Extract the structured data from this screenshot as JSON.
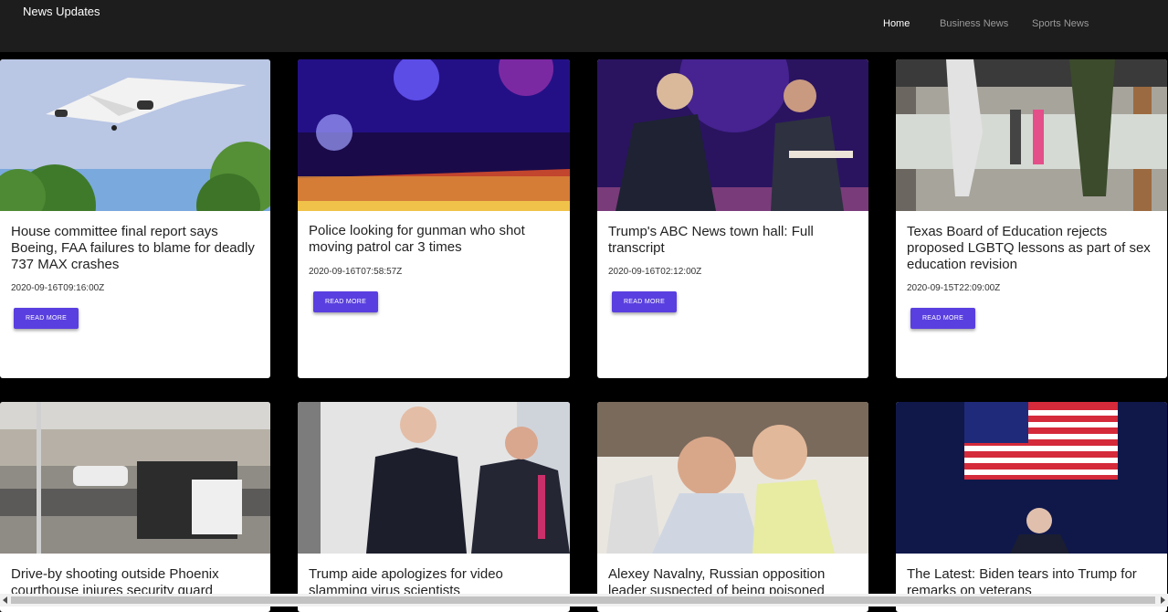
{
  "header": {
    "brand": "News Updates",
    "nav": [
      {
        "label": "Home",
        "active": true
      },
      {
        "label": "Business News",
        "active": false
      },
      {
        "label": "Sports News",
        "active": false
      }
    ]
  },
  "cards": [
    {
      "title": "House committee final report says Boeing, FAA failures to blame for deadly 737 MAX crashes",
      "date": "2020-09-16T09:16:00Z",
      "button": "READ MORE",
      "image": "airplane-photo"
    },
    {
      "title": "Police looking for gunman who shot moving patrol car 3 times",
      "date": "2020-09-16T07:58:57Z",
      "button": "READ MORE",
      "image": "police-tape-photo"
    },
    {
      "title": "Trump's ABC News town hall: Full transcript",
      "date": "2020-09-16T02:12:00Z",
      "button": "READ MORE",
      "image": "town-hall-photo"
    },
    {
      "title": "Texas Board of Education rejects proposed LGBTQ lessons as part of sex education revision",
      "date": "2020-09-15T22:09:00Z",
      "button": "READ MORE",
      "image": "school-students-photo"
    },
    {
      "title": "Drive-by shooting outside Phoenix courthouse injures security guard",
      "date": "",
      "button": "",
      "image": "street-photo"
    },
    {
      "title": "Trump aide apologizes for video slamming virus scientists",
      "date": "",
      "button": "",
      "image": "aide-photo"
    },
    {
      "title": "Alexey Navalny, Russian opposition leader suspected of being poisoned",
      "date": "",
      "button": "",
      "image": "hospital-photo"
    },
    {
      "title": "The Latest: Biden tears into Trump for remarks on veterans",
      "date": "",
      "button": "",
      "image": "flag-photo"
    }
  ]
}
